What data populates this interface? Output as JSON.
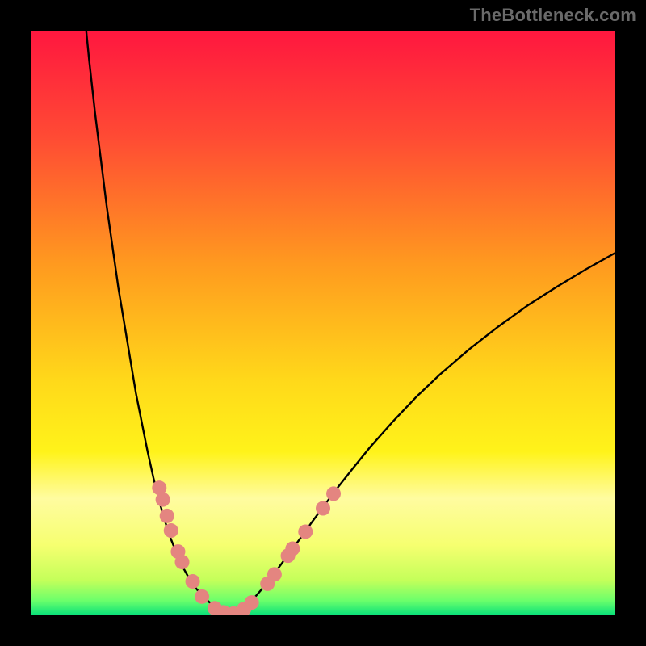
{
  "watermark": "TheBottleneck.com",
  "chart_data": {
    "type": "line",
    "title": "",
    "xlabel": "",
    "ylabel": "",
    "xlim": [
      0,
      100
    ],
    "ylim": [
      0,
      100
    ],
    "grid": false,
    "legend": false,
    "gradient_stops": [
      {
        "offset": 0.0,
        "color": "#ff173f"
      },
      {
        "offset": 0.18,
        "color": "#ff4a34"
      },
      {
        "offset": 0.4,
        "color": "#ff9a1f"
      },
      {
        "offset": 0.6,
        "color": "#ffd91a"
      },
      {
        "offset": 0.72,
        "color": "#fff31a"
      },
      {
        "offset": 0.8,
        "color": "#fffca0"
      },
      {
        "offset": 0.88,
        "color": "#f6ff70"
      },
      {
        "offset": 0.94,
        "color": "#c4ff5a"
      },
      {
        "offset": 0.975,
        "color": "#6bff6b"
      },
      {
        "offset": 1.0,
        "color": "#07e07a"
      }
    ],
    "series": [
      {
        "name": "bottleneck-curve",
        "x": [
          9.5,
          10,
          11,
          12,
          13,
          14,
          15,
          16,
          17,
          18,
          19,
          20,
          21,
          22,
          23,
          24,
          25,
          26,
          27,
          28,
          29,
          30,
          31,
          32,
          33,
          34,
          35,
          36,
          38,
          40,
          42,
          44,
          46,
          48,
          50,
          52,
          55,
          58,
          62,
          66,
          70,
          75,
          80,
          85,
          90,
          95,
          100
        ],
        "y": [
          100,
          95,
          86,
          78,
          70,
          63,
          56,
          50,
          44,
          38,
          33,
          28,
          23.5,
          19.5,
          16,
          13,
          10.5,
          8.3,
          6.5,
          5.0,
          3.7,
          2.7,
          1.9,
          1.2,
          0.7,
          0.3,
          0.2,
          0.9,
          2.7,
          5.0,
          7.6,
          10.3,
          13.0,
          15.8,
          18.5,
          21.2,
          25.0,
          28.7,
          33.2,
          37.4,
          41.2,
          45.5,
          49.4,
          53.0,
          56.2,
          59.2,
          62.0
        ]
      }
    ],
    "marker_color": "#e48580",
    "marker_radius_px": 9,
    "markers": [
      {
        "x": 22.0,
        "y": 21.8
      },
      {
        "x": 22.6,
        "y": 19.8
      },
      {
        "x": 23.3,
        "y": 17.0
      },
      {
        "x": 24.0,
        "y": 14.5
      },
      {
        "x": 25.2,
        "y": 10.9
      },
      {
        "x": 25.9,
        "y": 9.1
      },
      {
        "x": 27.7,
        "y": 5.8
      },
      {
        "x": 29.3,
        "y": 3.2
      },
      {
        "x": 31.5,
        "y": 1.2
      },
      {
        "x": 33.0,
        "y": 0.5
      },
      {
        "x": 34.7,
        "y": 0.3
      },
      {
        "x": 36.5,
        "y": 1.1
      },
      {
        "x": 37.8,
        "y": 2.2
      },
      {
        "x": 40.5,
        "y": 5.4
      },
      {
        "x": 41.7,
        "y": 7.0
      },
      {
        "x": 44.0,
        "y": 10.2
      },
      {
        "x": 44.8,
        "y": 11.4
      },
      {
        "x": 47.0,
        "y": 14.3
      },
      {
        "x": 50.0,
        "y": 18.3
      },
      {
        "x": 51.8,
        "y": 20.8
      }
    ]
  }
}
